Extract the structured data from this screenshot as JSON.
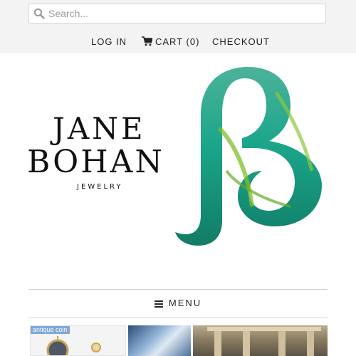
{
  "search": {
    "placeholder": "Search..."
  },
  "nav": {
    "login": "LOG IN",
    "cart": "CART (0)",
    "checkout": "CHECKOUT"
  },
  "brand": {
    "line1": "JANE",
    "line2": "BOHAN",
    "line3": "JEWELRY",
    "monogram": "ß"
  },
  "menu": {
    "label": "MENU",
    "icon": "hamburger-icon"
  },
  "thumbnails": [
    {
      "tag": "antique coin"
    },
    {},
    {}
  ],
  "colors": {
    "topbar": "#f3f3f3",
    "text": "#222222",
    "rule": "#cfcfcf",
    "monogram_sea": "#1aa58a",
    "monogram_kelp": "#7fbf2a"
  }
}
